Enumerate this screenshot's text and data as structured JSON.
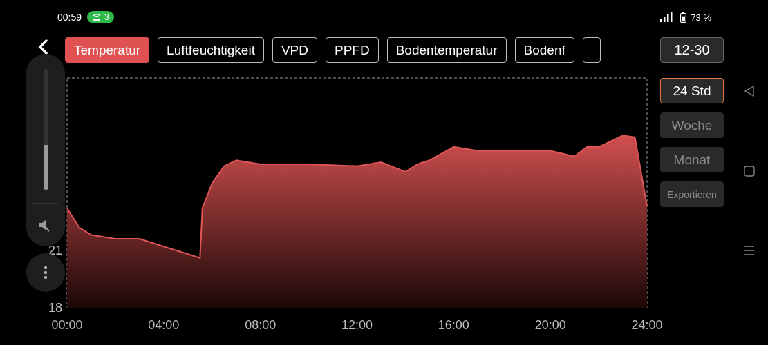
{
  "status_bar": {
    "time": "00:59",
    "hotspot_count": "3",
    "battery": "73 %"
  },
  "tabs": [
    {
      "label": "Temperatur",
      "selected": true
    },
    {
      "label": "Luftfeuchtigkeit",
      "selected": false
    },
    {
      "label": "VPD",
      "selected": false
    },
    {
      "label": "PPFD",
      "selected": false
    },
    {
      "label": "Bodentemperatur",
      "selected": false
    },
    {
      "label": "Bodenf",
      "selected": false
    },
    {
      "selected": false
    }
  ],
  "date_button": "12-30",
  "ranges": [
    {
      "label": "24 Std",
      "selected": true
    },
    {
      "label": "Woche",
      "selected": false
    },
    {
      "label": "Monat",
      "selected": false
    }
  ],
  "export_button": "Exportieren",
  "volume_panel": {
    "level": 0.37,
    "muted": true
  },
  "chart_data": {
    "type": "area",
    "x": [
      0,
      0.5,
      1,
      2,
      3,
      4,
      5,
      5.5,
      5.6,
      6,
      6.5,
      7,
      8,
      10,
      12,
      13,
      14,
      14.5,
      15,
      16,
      17,
      18,
      19,
      20,
      21,
      21.5,
      22,
      22.5,
      23,
      23.5,
      24
    ],
    "series": [
      {
        "color": "#e05555",
        "values": [
          23.2,
          22.2,
          21.8,
          21.6,
          21.6,
          21.2,
          20.8,
          20.6,
          23.2,
          24.5,
          25.4,
          25.7,
          25.5,
          25.5,
          25.4,
          25.6,
          25.1,
          25.5,
          25.7,
          26.4,
          26.2,
          26.2,
          26.2,
          26.2,
          25.9,
          26.4,
          26.4,
          26.7,
          27.0,
          26.9,
          23.3
        ]
      }
    ],
    "xlim": [
      0,
      24
    ],
    "ylim": [
      18,
      30
    ],
    "xticks": [
      {
        "value": 0,
        "label": "00:00"
      },
      {
        "value": 4,
        "label": "04:00"
      },
      {
        "value": 8,
        "label": "08:00"
      },
      {
        "value": 12,
        "label": "12:00"
      },
      {
        "value": 16,
        "label": "16:00"
      },
      {
        "value": 20,
        "label": "20:00"
      },
      {
        "value": 24,
        "label": "24:00"
      }
    ],
    "yticks": [
      18,
      21
    ]
  }
}
